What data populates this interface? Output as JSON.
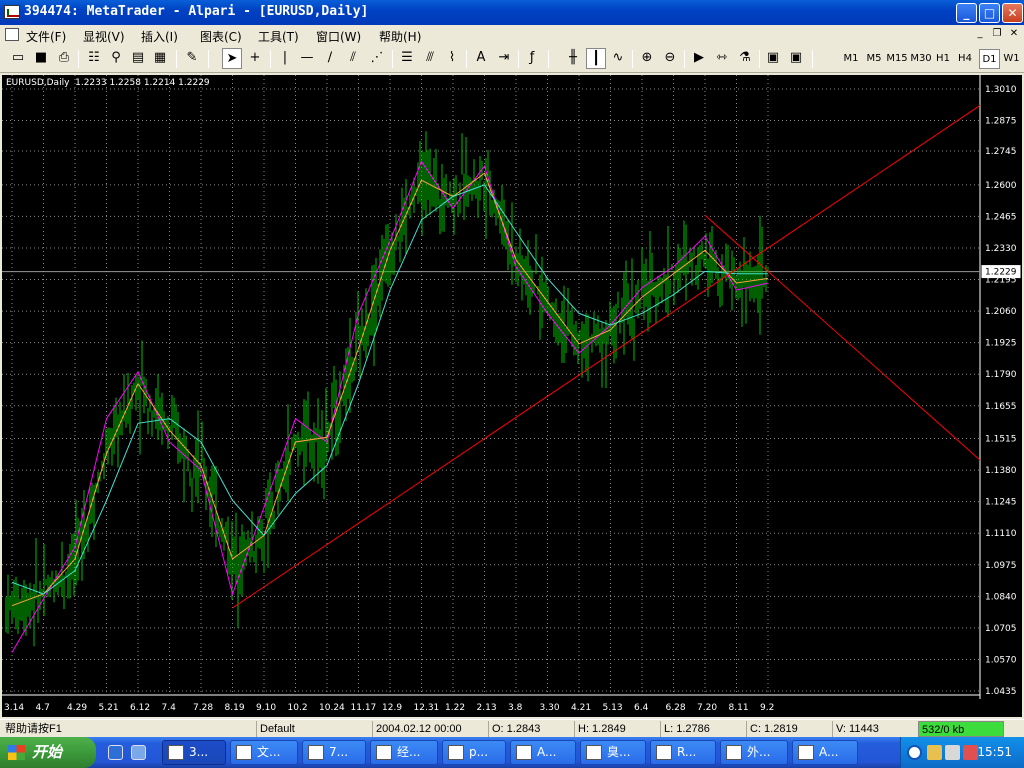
{
  "window": {
    "title": "394474: MetaTrader - Alpari - [EURUSD,Daily]"
  },
  "menubar": {
    "items": [
      "文件(F)",
      "显视(V)",
      "插入(I)",
      "图表(C)",
      "工具(T)",
      "窗口(W)",
      "帮助(H)"
    ]
  },
  "toolbar": {
    "timeframes": [
      "M1",
      "M5",
      "M15",
      "M30",
      "H1",
      "H4",
      "D1",
      "W1"
    ],
    "active_timeframe": "D1"
  },
  "chart": {
    "symbol_info": "EURUSD,Daily  1.2233 1.2258 1.2214 1.2229",
    "current_price_label": "1.2229",
    "price_labels": [
      "1.3010",
      "1.2875",
      "1.2745",
      "1.2600",
      "1.2465",
      "1.2330",
      "1.2195",
      "1.2060",
      "1.1925",
      "1.1790",
      "1.1655",
      "1.1515",
      "1.1380",
      "1.1245",
      "1.1110",
      "1.0975",
      "1.0840",
      "1.0705",
      "1.0570",
      "1.0435"
    ],
    "date_labels": [
      "3.14",
      "4.7",
      "4.29",
      "5.21",
      "6.12",
      "7.4",
      "7.28",
      "8.19",
      "9.10",
      "10.2",
      "10.24",
      "11.17",
      "12.9",
      "12.31",
      "1.22",
      "2.13",
      "3.8",
      "3.30",
      "4.21",
      "5.13",
      "6.4",
      "6.28",
      "7.20",
      "8.11",
      "9.2"
    ],
    "colors": {
      "background": "#000000",
      "grid": "#8A8A8A",
      "candles": "#00C000",
      "ma_fast": "#FF00FF",
      "ma_medium": "#FF9F40",
      "ma_slow": "#40E0D0",
      "trendlines": "#FF0000",
      "axis_text": "#FFFFFF"
    }
  },
  "chart_data": {
    "type": "line",
    "symbol": "EURUSD",
    "timeframe": "Daily",
    "last_bar": {
      "open": 1.2233,
      "high": 1.2258,
      "low": 1.2214,
      "close": 1.2229
    },
    "ylim": [
      1.0435,
      1.301
    ],
    "x": [
      "3.14",
      "4.7",
      "4.29",
      "5.21",
      "6.12",
      "7.4",
      "7.28",
      "8.19",
      "9.10",
      "10.2",
      "10.24",
      "11.17",
      "12.9",
      "12.31",
      "1.22",
      "2.13",
      "3.8",
      "3.30",
      "4.21",
      "5.13",
      "6.4",
      "6.28",
      "7.20",
      "8.11",
      "9.2"
    ],
    "series": [
      {
        "values": [
          1.06,
          1.083,
          1.105,
          1.16,
          1.18,
          1.15,
          1.138,
          1.085,
          1.122,
          1.16,
          1.15,
          1.205,
          1.236,
          1.27,
          1.25,
          1.268,
          1.225,
          1.205,
          1.188,
          1.2,
          1.216,
          1.225,
          1.238,
          1.215,
          1.218
        ]
      },
      {
        "values": [
          1.08,
          1.085,
          1.1,
          1.145,
          1.175,
          1.155,
          1.14,
          1.1,
          1.11,
          1.15,
          1.152,
          1.19,
          1.232,
          1.262,
          1.255,
          1.265,
          1.228,
          1.21,
          1.192,
          1.198,
          1.212,
          1.222,
          1.232,
          1.218,
          1.22
        ]
      },
      {
        "values": [
          1.09,
          1.085,
          1.095,
          1.125,
          1.158,
          1.16,
          1.15,
          1.125,
          1.11,
          1.128,
          1.14,
          1.175,
          1.215,
          1.245,
          1.255,
          1.26,
          1.24,
          1.22,
          1.205,
          1.2,
          1.205,
          1.213,
          1.223,
          1.222,
          1.222
        ]
      }
    ],
    "trendlines": [
      {
        "points": [
          [
            "8.19",
            1.079
          ],
          [
            "9.2",
            1.233
          ]
        ]
      },
      {
        "points": [
          [
            "7.20",
            1.247
          ],
          [
            "9.2",
            1.223
          ]
        ]
      }
    ]
  },
  "statusbar": {
    "help": "帮助请按F1",
    "profile": "Default",
    "datetime": "2004.02.12 00:00",
    "open": "O: 1.2843",
    "high": "H: 1.2849",
    "low": "L: 1.2786",
    "close": "C: 1.2819",
    "volume": "V: 11443",
    "traffic": "532/0 kb"
  },
  "taskbar": {
    "start_label": "开始",
    "tasks": [
      "3...",
      "文...",
      "7...",
      "经...",
      "p...",
      "A...",
      "臭...",
      "R...",
      "外...",
      "A..."
    ],
    "clock": "15:51"
  }
}
